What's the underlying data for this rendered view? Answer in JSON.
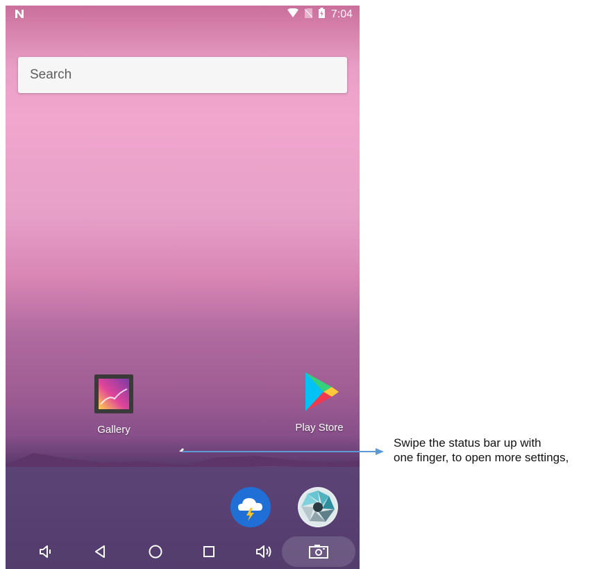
{
  "status_bar": {
    "left_icon": "n-logo-icon",
    "icons": [
      "wifi-icon",
      "no-sim-icon",
      "battery-icon"
    ],
    "time": "7:04"
  },
  "search": {
    "placeholder": "Search"
  },
  "home_apps": [
    {
      "label": "Gallery",
      "icon": "gallery-icon"
    },
    {
      "label": "Play Store",
      "icon": "play-store-icon"
    }
  ],
  "dock": [
    {
      "icon": "weather-icon",
      "color": "#1f6fd6"
    },
    {
      "icon": "camera-aperture-icon",
      "color": "#4fb3bf"
    }
  ],
  "nav_bar": [
    "volume-down-icon",
    "back-icon",
    "home-icon",
    "recents-icon",
    "volume-up-icon",
    "screenshot-icon"
  ],
  "annotation": {
    "text": "Swipe the status bar up with\none finger, to open more settings,",
    "arrow_color": "#5b9bd5"
  },
  "colors": {
    "search_bg": "#f6f6f7",
    "text_gray": "#5d5d5d"
  }
}
